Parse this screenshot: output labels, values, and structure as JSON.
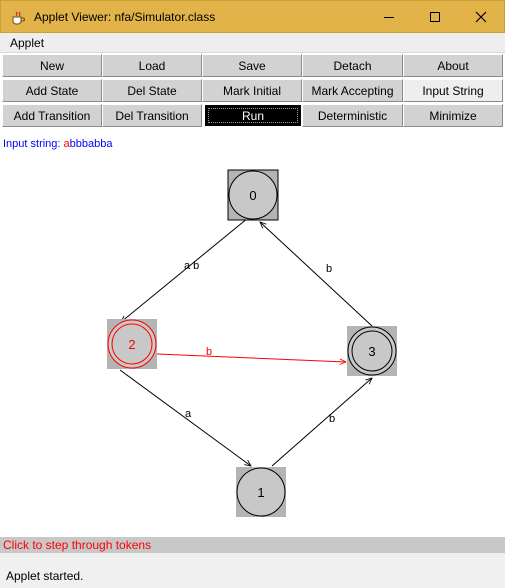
{
  "window": {
    "title": "Applet Viewer: nfa/Simulator.class",
    "app_icon": "java-cup-icon",
    "controls": [
      "minimize-icon",
      "maximize-icon",
      "close-icon"
    ]
  },
  "menubar": {
    "applet_label": "Applet"
  },
  "toolbar": {
    "row1": [
      "New",
      "Load",
      "Save",
      "Detach",
      "About"
    ],
    "row2": [
      "Add State",
      "Del State",
      "Mark Initial",
      "Mark Accepting",
      "Input String"
    ],
    "row3": [
      "Add Transition",
      "Del Transition",
      "Run",
      "Deterministic",
      "Minimize"
    ]
  },
  "input": {
    "label": "Input string: ",
    "consumed": "a",
    "remaining": "bbbabba"
  },
  "automaton": {
    "states": [
      {
        "id": "0",
        "initial": true,
        "accepting": false,
        "active": false
      },
      {
        "id": "1",
        "initial": false,
        "accepting": false,
        "active": false
      },
      {
        "id": "2",
        "initial": false,
        "accepting": true,
        "active": true
      },
      {
        "id": "3",
        "initial": false,
        "accepting": true,
        "active": false
      }
    ],
    "transitions": [
      {
        "from": "0",
        "to": "2",
        "label": "a b",
        "active": false
      },
      {
        "from": "3",
        "to": "0",
        "label": "b",
        "active": false
      },
      {
        "from": "2",
        "to": "3",
        "label": "b",
        "active": true
      },
      {
        "from": "2",
        "to": "1",
        "label": "a",
        "active": false
      },
      {
        "from": "1",
        "to": "3",
        "label": "b",
        "active": false
      }
    ]
  },
  "colors": {
    "titlebar": "#e2b348",
    "active_state": "#ff0000",
    "state_fill": "#c8c8c8",
    "state_box": "#b4b4b4",
    "input_text": "#0000ff"
  },
  "status": {
    "hint": "Click to step through tokens",
    "applet": "Applet started."
  }
}
